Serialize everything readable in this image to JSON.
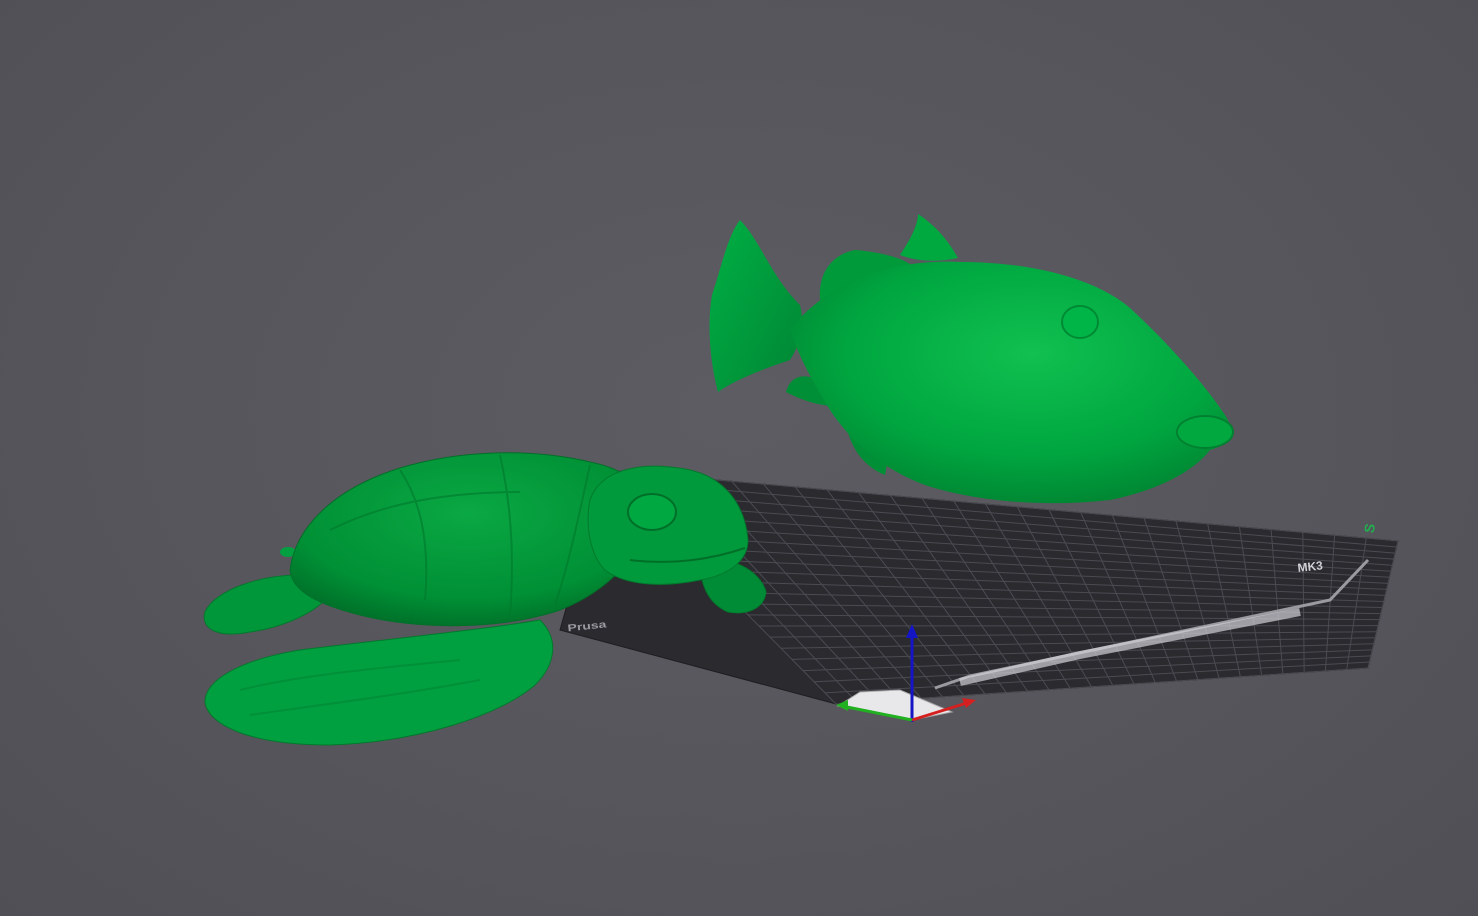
{
  "viewport": {
    "background_color": "#56565c",
    "model_color": "#00a33f",
    "bed_color": "#2b2b30",
    "grid_color": "#4a4a50"
  },
  "bed": {
    "brand_text": "Prusa",
    "version_text": "MK3",
    "corner_mark": "S",
    "axis_colors": {
      "x": "#e02020",
      "y": "#20c020",
      "z": "#1010d0"
    }
  },
  "objects": [
    {
      "name": "sea-turtle",
      "icon": "turtle-model"
    },
    {
      "name": "triggerfish",
      "icon": "fish-model"
    }
  ]
}
